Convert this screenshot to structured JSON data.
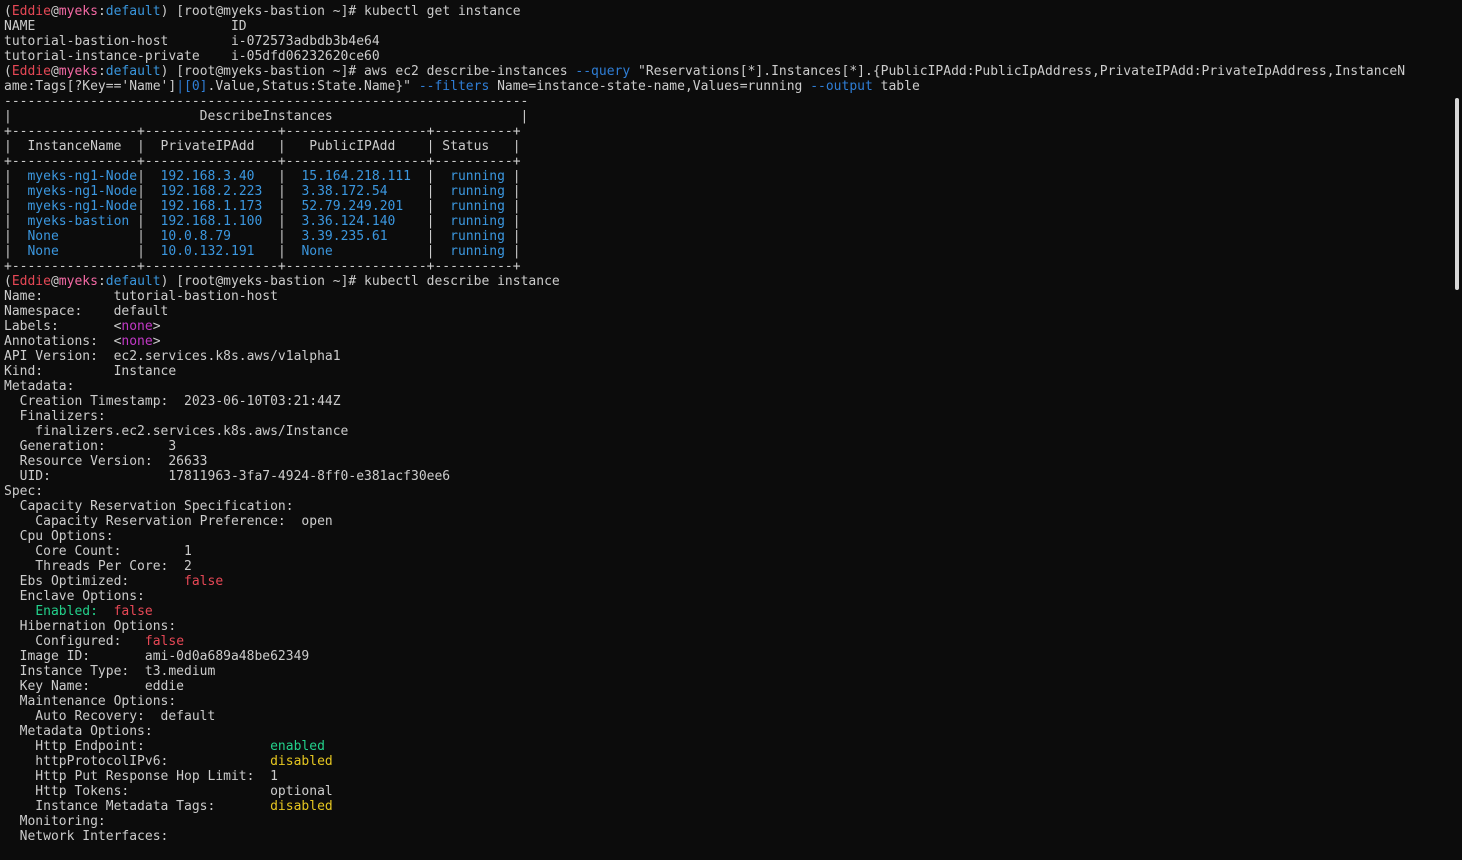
{
  "terminal": {
    "colors": {
      "background": "#0c0c0c",
      "default": "#cccccc",
      "red": "#e74856",
      "pink": "#f56aa5",
      "cyan": "#3a96dd",
      "blue": "#2f7ed6",
      "tealblue": "#3b97df",
      "magenta": "#c239c6",
      "green": "#16c60c",
      "bgreen": "#23d18b",
      "yellow": "#e5c620"
    },
    "lines": [
      [
        {
          "t": "("
        },
        {
          "t": "Eddie",
          "c": "red"
        },
        {
          "t": "@"
        },
        {
          "t": "myeks",
          "c": "pink"
        },
        {
          "t": ":"
        },
        {
          "t": "default",
          "c": "cyan"
        },
        {
          "t": ") [root@myeks-bastion ~]# kubectl get instance"
        }
      ],
      [
        {
          "t": "NAME                         ID"
        }
      ],
      [
        {
          "t": "tutorial-bastion-host        i-072573adbdb3b4e64"
        }
      ],
      [
        {
          "t": "tutorial-instance-private    i-05dfd06232620ce60"
        }
      ],
      [
        {
          "t": "("
        },
        {
          "t": "Eddie",
          "c": "red"
        },
        {
          "t": "@"
        },
        {
          "t": "myeks",
          "c": "pink"
        },
        {
          "t": ":"
        },
        {
          "t": "default",
          "c": "cyan"
        },
        {
          "t": ") [root@myeks-bastion ~]# aws ec2 describe-instances "
        },
        {
          "t": "--query",
          "c": "blue"
        },
        {
          "t": " \"Reservations[*].Instances[*].{PublicIPAdd:PublicIpAddress,PrivateIPAdd:PrivateIpAddress,InstanceN"
        }
      ],
      [
        {
          "t": "ame:Tags[?Key=='Name']"
        },
        {
          "t": "|[0]",
          "c": "blue"
        },
        {
          "t": ".Value,Status:State.Name}\" "
        },
        {
          "t": "--filters",
          "c": "blue"
        },
        {
          "t": " Name=instance-state-name,Values=running "
        },
        {
          "t": "--output",
          "c": "blue"
        },
        {
          "t": " table"
        }
      ],
      [
        {
          "t": "-------------------------------------------------------------------"
        }
      ],
      [
        {
          "t": "|                        DescribeInstances                        |"
        }
      ],
      [
        {
          "t": "+----------------+-----------------+------------------+----------+"
        }
      ],
      [
        {
          "t": "|  InstanceName  |  PrivateIPAdd   |   PublicIPAdd    | Status   |"
        }
      ],
      [
        {
          "t": "+----------------+-----------------+------------------+----------+"
        }
      ],
      [
        {
          "t": "|  "
        },
        {
          "t": "myeks-ng1-Node",
          "c": "tealblue"
        },
        {
          "t": "|  "
        },
        {
          "t": "192.168.3.40",
          "c": "tealblue"
        },
        {
          "t": "   |  "
        },
        {
          "t": "15.164.218.111",
          "c": "tealblue"
        },
        {
          "t": "  |  "
        },
        {
          "t": "running",
          "c": "tealblue"
        },
        {
          "t": " |"
        }
      ],
      [
        {
          "t": "|  "
        },
        {
          "t": "myeks-ng1-Node",
          "c": "tealblue"
        },
        {
          "t": "|  "
        },
        {
          "t": "192.168.2.223",
          "c": "tealblue"
        },
        {
          "t": "  |  "
        },
        {
          "t": "3.38.172.54",
          "c": "tealblue"
        },
        {
          "t": "     |  "
        },
        {
          "t": "running",
          "c": "tealblue"
        },
        {
          "t": " |"
        }
      ],
      [
        {
          "t": "|  "
        },
        {
          "t": "myeks-ng1-Node",
          "c": "tealblue"
        },
        {
          "t": "|  "
        },
        {
          "t": "192.168.1.173",
          "c": "tealblue"
        },
        {
          "t": "  |  "
        },
        {
          "t": "52.79.249.201",
          "c": "tealblue"
        },
        {
          "t": "   |  "
        },
        {
          "t": "running",
          "c": "tealblue"
        },
        {
          "t": " |"
        }
      ],
      [
        {
          "t": "|  "
        },
        {
          "t": "myeks-bastion",
          "c": "tealblue"
        },
        {
          "t": " |  "
        },
        {
          "t": "192.168.1.100",
          "c": "tealblue"
        },
        {
          "t": "  |  "
        },
        {
          "t": "3.36.124.140",
          "c": "tealblue"
        },
        {
          "t": "    |  "
        },
        {
          "t": "running",
          "c": "tealblue"
        },
        {
          "t": " |"
        }
      ],
      [
        {
          "t": "|  "
        },
        {
          "t": "None",
          "c": "tealblue"
        },
        {
          "t": "          |  "
        },
        {
          "t": "10.0.8.79",
          "c": "tealblue"
        },
        {
          "t": "      |  "
        },
        {
          "t": "3.39.235.61",
          "c": "tealblue"
        },
        {
          "t": "     |  "
        },
        {
          "t": "running",
          "c": "tealblue"
        },
        {
          "t": " |"
        }
      ],
      [
        {
          "t": "|  "
        },
        {
          "t": "None",
          "c": "tealblue"
        },
        {
          "t": "          |  "
        },
        {
          "t": "10.0.132.191",
          "c": "tealblue"
        },
        {
          "t": "   |  "
        },
        {
          "t": "None",
          "c": "tealblue"
        },
        {
          "t": "            |  "
        },
        {
          "t": "running",
          "c": "tealblue"
        },
        {
          "t": " |"
        }
      ],
      [
        {
          "t": "+----------------+-----------------+------------------+----------+"
        }
      ],
      [
        {
          "t": "("
        },
        {
          "t": "Eddie",
          "c": "red"
        },
        {
          "t": "@"
        },
        {
          "t": "myeks",
          "c": "pink"
        },
        {
          "t": ":"
        },
        {
          "t": "default",
          "c": "cyan"
        },
        {
          "t": ") [root@myeks-bastion ~]# kubectl describe instance"
        }
      ],
      [
        {
          "t": "Name:         tutorial-bastion-host"
        }
      ],
      [
        {
          "t": "Namespace:    default"
        }
      ],
      [
        {
          "t": "Labels:       <"
        },
        {
          "t": "none",
          "c": "magenta"
        },
        {
          "t": ">"
        }
      ],
      [
        {
          "t": "Annotations:  <"
        },
        {
          "t": "none",
          "c": "magenta"
        },
        {
          "t": ">"
        }
      ],
      [
        {
          "t": "API Version:  ec2.services.k8s.aws/v1alpha1"
        }
      ],
      [
        {
          "t": "Kind:         Instance"
        }
      ],
      [
        {
          "t": "Metadata:"
        }
      ],
      [
        {
          "t": "  Creation Timestamp:  2023-06-10T03:21:44Z"
        }
      ],
      [
        {
          "t": "  Finalizers:"
        }
      ],
      [
        {
          "t": "    finalizers.ec2.services.k8s.aws/Instance"
        }
      ],
      [
        {
          "t": "  Generation:        3"
        }
      ],
      [
        {
          "t": "  Resource Version:  26633"
        }
      ],
      [
        {
          "t": "  UID:               17811963-3fa7-4924-8ff0-e381acf30ee6"
        }
      ],
      [
        {
          "t": "Spec:"
        }
      ],
      [
        {
          "t": "  Capacity Reservation Specification:"
        }
      ],
      [
        {
          "t": "    Capacity Reservation Preference:  open"
        }
      ],
      [
        {
          "t": "  Cpu Options:"
        }
      ],
      [
        {
          "t": "    Core Count:        1"
        }
      ],
      [
        {
          "t": "    Threads Per Core:  2"
        }
      ],
      [
        {
          "t": "  Ebs Optimized:       "
        },
        {
          "t": "false",
          "c": "red"
        }
      ],
      [
        {
          "t": "  Enclave Options:"
        }
      ],
      [
        {
          "t": "    "
        },
        {
          "t": "Enabled:",
          "c": "bgreen"
        },
        {
          "t": "  "
        },
        {
          "t": "false",
          "c": "red"
        }
      ],
      [
        {
          "t": "  Hibernation Options:"
        }
      ],
      [
        {
          "t": "    Configured:   "
        },
        {
          "t": "false",
          "c": "red"
        }
      ],
      [
        {
          "t": "  Image ID:       ami-0d0a689a48be62349"
        }
      ],
      [
        {
          "t": "  Instance Type:  t3.medium"
        }
      ],
      [
        {
          "t": "  Key Name:       eddie"
        }
      ],
      [
        {
          "t": "  Maintenance Options:"
        }
      ],
      [
        {
          "t": "    Auto Recovery:  default"
        }
      ],
      [
        {
          "t": "  Metadata Options:"
        }
      ],
      [
        {
          "t": "    Http Endpoint:                "
        },
        {
          "t": "enabled",
          "c": "bgreen"
        }
      ],
      [
        {
          "t": "    httpProtocolIPv6:             "
        },
        {
          "t": "disabled",
          "c": "yellow"
        }
      ],
      [
        {
          "t": "    Http Put Response Hop Limit:  1"
        }
      ],
      [
        {
          "t": "    Http Tokens:                  optional"
        }
      ],
      [
        {
          "t": "    Instance Metadata Tags:       "
        },
        {
          "t": "disabled",
          "c": "yellow"
        }
      ],
      [
        {
          "t": "  Monitoring:"
        }
      ],
      [
        {
          "t": "  Network Interfaces:"
        }
      ]
    ]
  }
}
